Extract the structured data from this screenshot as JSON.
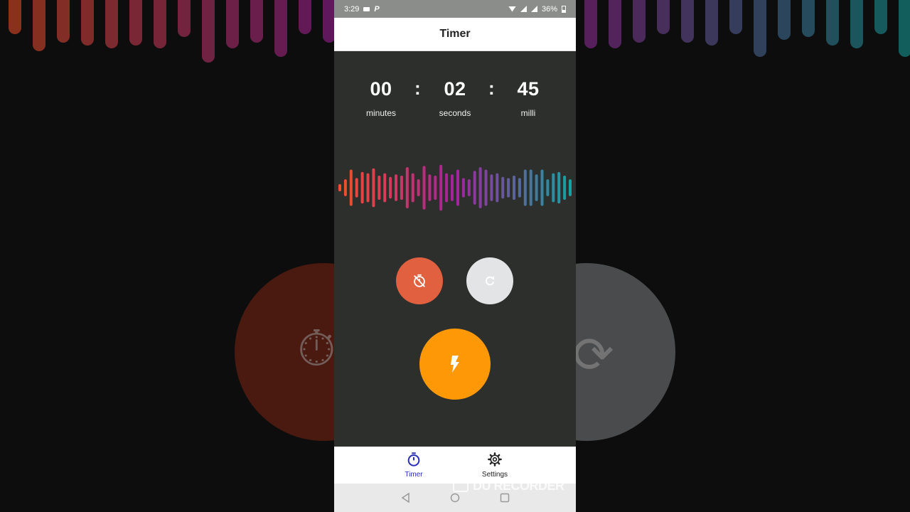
{
  "status_bar": {
    "time": "3:29",
    "app_badge": "P",
    "battery": "36%"
  },
  "header": {
    "title": "Timer"
  },
  "timer": {
    "minutes": "00",
    "seconds": "02",
    "milli": "45",
    "separator": ":",
    "minutes_label": "minutes",
    "seconds_label": "seconds",
    "milli_label": "milli"
  },
  "waveform": {
    "start_color": "#f0502a",
    "mid_color": "#a4229c",
    "end_color": "#15a3a0",
    "levels": [
      0.15,
      0.35,
      0.75,
      0.4,
      0.65,
      0.6,
      0.8,
      0.5,
      0.6,
      0.45,
      0.55,
      0.5,
      0.85,
      0.6,
      0.35,
      0.9,
      0.55,
      0.5,
      0.95,
      0.6,
      0.55,
      0.75,
      0.4,
      0.35,
      0.7,
      0.85,
      0.75,
      0.55,
      0.6,
      0.45,
      0.4,
      0.5,
      0.4,
      0.75,
      0.75,
      0.55,
      0.75,
      0.35,
      0.6,
      0.65,
      0.5,
      0.35
    ]
  },
  "controls": {
    "stop_color": "#e0603f",
    "reset_color": "#e2e4e6",
    "flash_color": "#ff9806",
    "stop_icon": "timer-off-icon",
    "reset_icon": "refresh-icon",
    "flash_icon": "flash-icon"
  },
  "bottom_nav": {
    "items": [
      {
        "label": "Timer",
        "icon": "stopwatch-icon",
        "active": true
      },
      {
        "label": "Settings",
        "icon": "gear-icon",
        "active": false
      }
    ]
  },
  "watermark": {
    "text": "DU RECORDER"
  }
}
